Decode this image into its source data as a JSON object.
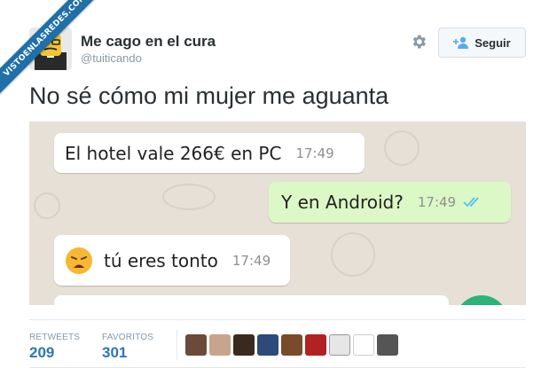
{
  "watermark": "VISTOENLASREDES.COM",
  "account": {
    "name": "Me cago en el cura",
    "handle": "@tuiticando",
    "avatar_icon": "lego-priest-avatar-icon"
  },
  "header": {
    "follow_label": "Seguir",
    "settings_icon": "gear-icon",
    "follow_icon": "add-user-icon"
  },
  "tweet": {
    "text": "No sé cómo mi mujer me aguanta"
  },
  "chat": {
    "messages": [
      {
        "text": "El hotel vale 266€ en PC",
        "time": "17:49",
        "direction": "incoming"
      },
      {
        "text": "Y en Android?",
        "time": "17:49",
        "direction": "outgoing",
        "status_icon": "double-check-icon"
      },
      {
        "text": "tú eres tonto",
        "time": "17:49",
        "direction": "incoming",
        "emoji_icon": "weary-face-icon"
      }
    ]
  },
  "stats": {
    "retweets_label": "RETWEETS",
    "retweets_value": "209",
    "favorites_label": "FAVORITOS",
    "favorites_value": "301"
  },
  "colors": {
    "link_blue": "#2f75b5",
    "chat_background": "#e7e0d6",
    "outgoing_bubble": "#dcf8c6",
    "ribbon": "#1f6fa8"
  }
}
